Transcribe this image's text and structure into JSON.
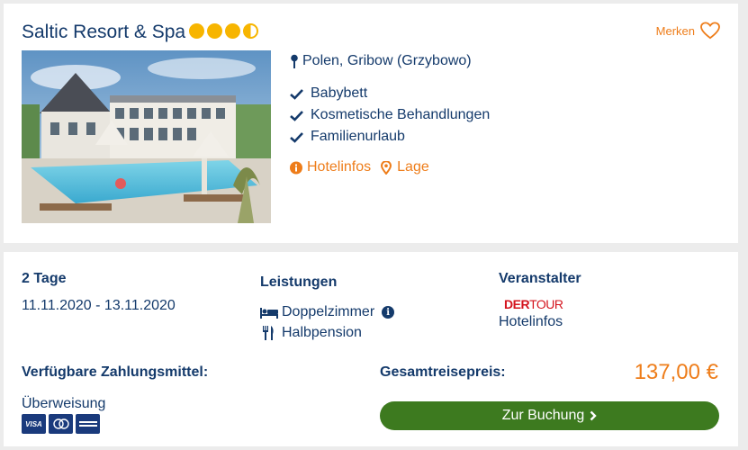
{
  "hotel": {
    "name": "Saltic Resort & Spa",
    "star_rating": 3.5,
    "merken_label": "Merken",
    "location": "Polen, Gribow (Grzybowo)",
    "features": [
      "Babybett",
      "Kosmetische Behandlungen",
      "Familienurlaub"
    ],
    "links": {
      "hotelinfos": "Hotelinfos",
      "lage": "Lage"
    }
  },
  "offer": {
    "duration": "2 Tage",
    "dates": "11.11.2020 - 13.11.2020",
    "leistungen_title": "Leistungen",
    "room": "Doppelzimmer",
    "board": "Halbpension",
    "veranstalter_title": "Veranstalter",
    "operator_logo": {
      "der": "DER",
      "tour": "TOUR"
    },
    "operator_link": "Hotelinfos",
    "payment_title": "Verfügbare Zahlungsmittel:",
    "payment_method": "Überweisung",
    "payment_cards": [
      "visa-card",
      "mastercard-card",
      "amex-card"
    ],
    "total_label": "Gesamtreisepreis:",
    "price": "137,00 €",
    "book_label": "Zur Buchung"
  },
  "colors": {
    "navy": "#143a6b",
    "orange": "#ee7d1a",
    "green": "#3d7a1f",
    "star": "#f7b500",
    "der_red": "#d4141e"
  }
}
